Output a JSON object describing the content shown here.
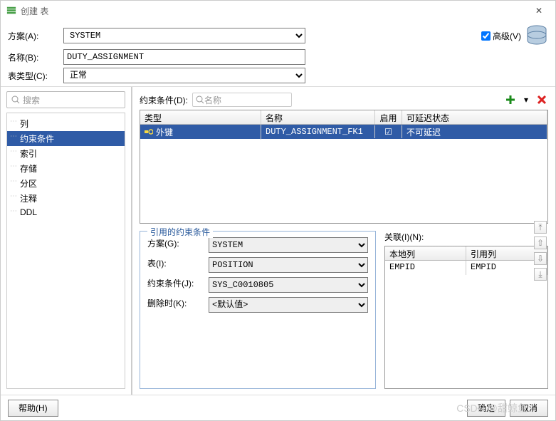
{
  "window": {
    "title": "创建 表"
  },
  "form": {
    "schema_label": "方案(A):",
    "schema_value": "SYSTEM",
    "name_label": "名称(B):",
    "name_value": "DUTY_ASSIGNMENT",
    "tabletype_label": "表类型(C):",
    "tabletype_value": "正常",
    "advanced_label": "高级(V)"
  },
  "left": {
    "search_placeholder": "搜索",
    "items": [
      "列",
      "约束条件",
      "索引",
      "存储",
      "分区",
      "注释",
      "DDL"
    ],
    "selected": "约束条件"
  },
  "constraints": {
    "label": "约束条件(D):",
    "search_placeholder": "名称",
    "headers": {
      "type": "类型",
      "name": "名称",
      "enabled": "启用",
      "defer": "可延迟状态"
    },
    "rows": [
      {
        "type": "外键",
        "name": "DUTY_ASSIGNMENT_FK1",
        "enabled": true,
        "defer": "不可延迟"
      }
    ]
  },
  "ref": {
    "legend": "引用的约束条件",
    "schema_label": "方案(G):",
    "schema_value": "SYSTEM",
    "table_label": "表(I):",
    "table_value": "POSITION",
    "constraint_label": "约束条件(J):",
    "constraint_value": "SYS_C0010805",
    "ondelete_label": "删除时(K):",
    "ondelete_value": "<默认值>"
  },
  "assoc": {
    "title": "关联(I)(N):",
    "headers": {
      "local": "本地列",
      "ref": "引用列"
    },
    "rows": [
      {
        "local": "EMPID",
        "ref": "EMPID"
      }
    ]
  },
  "footer": {
    "help": "帮助(H)",
    "ok": "确定",
    "cancel": "取消"
  },
  "watermark": "CSDN @甜鲸鱼"
}
